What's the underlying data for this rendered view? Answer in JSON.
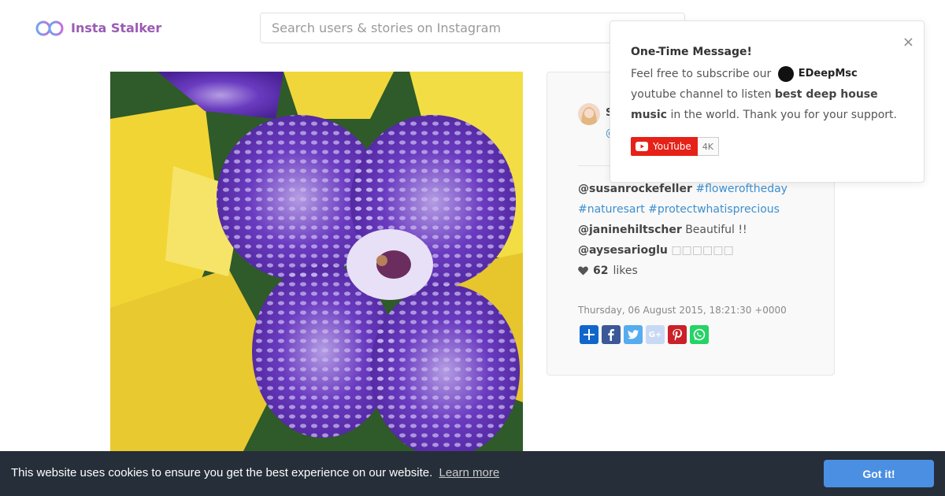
{
  "header": {
    "logo_text": "Insta Stalker",
    "search_placeholder": "Search users & stories on Instagram"
  },
  "post": {
    "user_initial": "S",
    "user_handle": "@",
    "comments": [
      {
        "user": "@susanrockefeller",
        "text": "#floweroftheday #naturesart #protectwhatisprecious"
      },
      {
        "user": "@janinehiltscher",
        "text": "Beautiful !!"
      },
      {
        "user": "@aysesarioglu",
        "text": "□□□□□□"
      }
    ],
    "likes_count": "62",
    "likes_label": "likes",
    "date": "Thursday, 06 August 2015, 18:21:30 +0000",
    "share_icons": [
      "share-plus-icon",
      "facebook-icon",
      "twitter-icon",
      "google-plus-icon",
      "pinterest-icon",
      "whatsapp-icon"
    ]
  },
  "popup": {
    "title": "One-Time Message!",
    "text_1": "Feel free to subscribe our",
    "brand": "EDeepMsc",
    "text_2": "youtube channel to listen",
    "bold": "best deep house music",
    "text_3": "in the world. Thank you for your support.",
    "yt_label": "YouTube",
    "yt_count": "4K",
    "close": "×"
  },
  "cookie": {
    "message": "This website uses cookies to ensure you get the best experience on our website.",
    "learn_more": "Learn more",
    "button": "Got it!"
  },
  "colors": {
    "accent": "#9b5bb4",
    "link": "#3d8fcf",
    "cookie_bg": "#252e39",
    "cookie_btn": "#4b8fe3",
    "youtube": "#e62117"
  }
}
